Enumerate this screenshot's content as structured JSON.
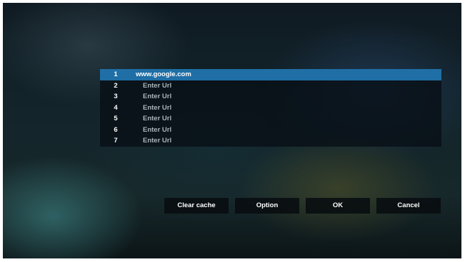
{
  "url_list": {
    "rows": [
      {
        "number": "1",
        "url": "www.google.com",
        "selected": true
      },
      {
        "number": "2",
        "url": "Enter Url",
        "selected": false
      },
      {
        "number": "3",
        "url": "Enter Url",
        "selected": false
      },
      {
        "number": "4",
        "url": "Enter Url",
        "selected": false
      },
      {
        "number": "5",
        "url": "Enter Url",
        "selected": false
      },
      {
        "number": "6",
        "url": "Enter Url",
        "selected": false
      },
      {
        "number": "7",
        "url": "Enter Url",
        "selected": false
      }
    ]
  },
  "buttons": {
    "clear_cache": "Clear cache",
    "option": "Option",
    "ok": "OK",
    "cancel": "Cancel"
  },
  "colors": {
    "selection": "#1f6fa6",
    "placeholder_text": "#a9b3b8",
    "text": "#ffffff"
  }
}
